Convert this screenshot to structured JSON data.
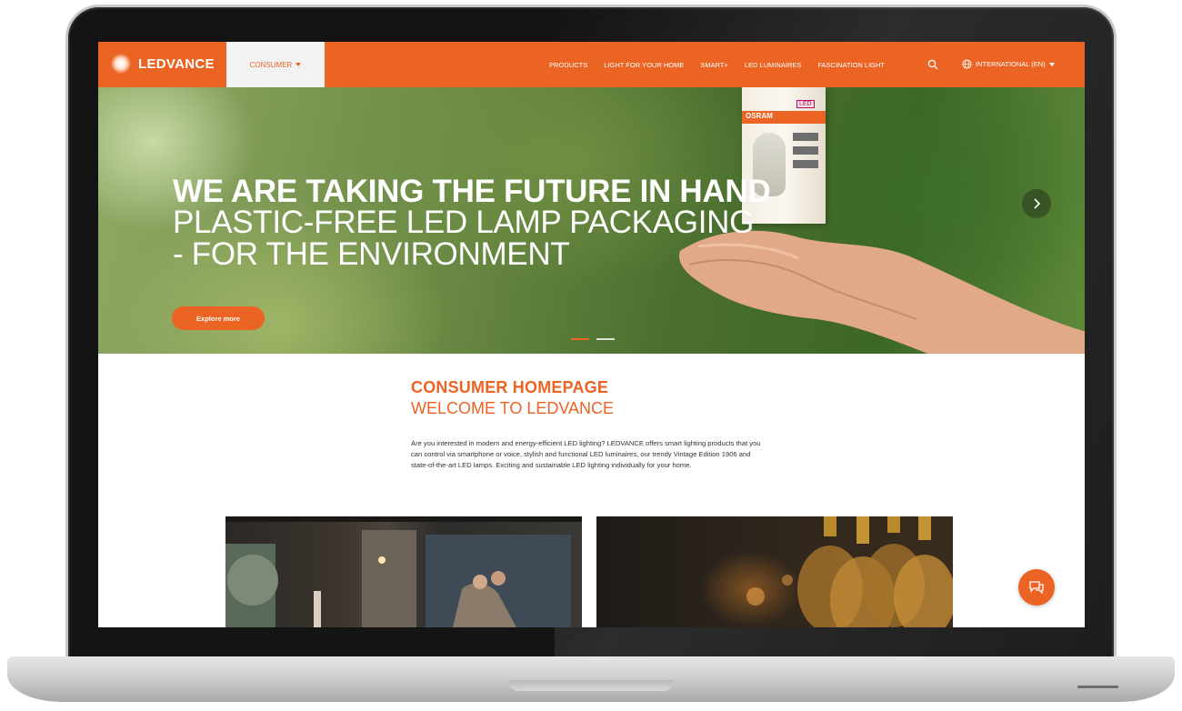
{
  "nav": {
    "logo_text": "LEDVANCE",
    "consumer_tab": "CONSUMER",
    "links": [
      "PRODUCTS",
      "LIGHT FOR YOUR HOME",
      "SMART+",
      "LED LUMINAIRES",
      "FASCINATION LIGHT"
    ],
    "language": "INTERNATIONAL (EN)"
  },
  "hero": {
    "title_line1": "WE ARE TAKING THE FUTURE IN HAND",
    "title_line2": "PLASTIC-FREE LED LAMP PACKAGING",
    "title_line3": "- FOR THE ENVIRONMENT",
    "cta_label": "Explore more",
    "package_brand": "OSRAM",
    "package_badge": "LED",
    "slide_count": 2,
    "active_slide": 1
  },
  "intro": {
    "heading": "CONSUMER HOMEPAGE",
    "subheading": "WELCOME TO LEDVANCE",
    "body": "Are you interested in modern and energy-efficient LED lighting? LEDVANCE offers smart lighting products that you can control via smartphone or voice, stylish and functional LED luminaires, our trendy Vintage Edition 1906 and state-of-the-art LED lamps. Exciting and sustainable LED lighting individually for your home."
  },
  "colors": {
    "brand_orange": "#eb6423",
    "consumer_tab_bg": "#f2f2f2",
    "text_dark": "#333333"
  },
  "icons": [
    "logo-mark-icon",
    "chevron-down-icon",
    "search-icon",
    "globe-icon",
    "chevron-right-icon",
    "chat-icon"
  ]
}
